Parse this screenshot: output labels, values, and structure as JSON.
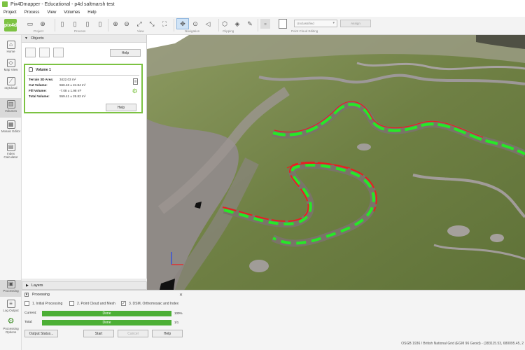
{
  "window": {
    "title": "Pix4Dmapper - Educational - p4d saltmarsh test"
  },
  "menu": [
    "Project",
    "Process",
    "View",
    "Volumes",
    "Help"
  ],
  "toolbar": {
    "groups": [
      "Project",
      "Process",
      "View",
      "Navigation",
      "Clipping",
      "Point Cloud Editing"
    ],
    "class_dropdown": "Unclassified",
    "assign_button": "Assign"
  },
  "logo": {
    "text": "pix4d"
  },
  "sidebar": {
    "items": [
      {
        "label": "Home",
        "icon": "home-icon"
      },
      {
        "label": "Map View",
        "icon": "map-view-icon"
      },
      {
        "label": "rayCloud",
        "icon": "raycloud-icon"
      },
      {
        "label": "Volumes",
        "icon": "volumes-icon"
      },
      {
        "label": "Mosaic Editor",
        "icon": "mosaic-editor-icon"
      },
      {
        "label": "Index Calculator",
        "icon": "index-calculator-icon"
      },
      {
        "label": "Processing",
        "icon": "processing-icon"
      },
      {
        "label": "Log Output",
        "icon": "log-output-icon"
      },
      {
        "label": "Processing Options",
        "icon": "processing-options-icon"
      }
    ]
  },
  "objects_panel": {
    "title": "Objects",
    "help_label": "Help",
    "volume": {
      "name": "Volume 1",
      "rows": [
        {
          "key": "Terrain 3D Area:",
          "value": "3422.03  m²"
        },
        {
          "key": "Cut Volume:",
          "value": "566.46 ± 24.84  m³"
        },
        {
          "key": "Fill Volume:",
          "value": "-7.08 ± 1.98  m³"
        },
        {
          "key": "Total Volume:",
          "value": "559.41 ± 26.82  m³"
        }
      ],
      "help_label": "Help"
    }
  },
  "layers": {
    "title": "Layers"
  },
  "processing": {
    "title": "Processing",
    "steps": [
      {
        "label": "1. Initial Processing",
        "checked": false
      },
      {
        "label": "2. Point Cloud and Mesh",
        "checked": false
      },
      {
        "label": "3. DSM, Orthomosaic and Index",
        "checked": true
      }
    ],
    "current_label": "Current:",
    "current_status": "Done",
    "current_pct": "100%",
    "total_label": "Total:",
    "total_status": "Done",
    "total_pct": "1/1",
    "buttons": {
      "output_status": "Output Status...",
      "start": "Start",
      "cancel": "Cancel",
      "help": "Help"
    }
  },
  "status_bar": {
    "text": "OSGB 1936 / British National Grid (EGM 96 Geoid) - (383115.53, 680095.45, 2"
  },
  "colors": {
    "accent": "#7cc242",
    "progress": "#4caf35",
    "cut_volume": "#e82020",
    "fill_volume": "#27e827"
  }
}
